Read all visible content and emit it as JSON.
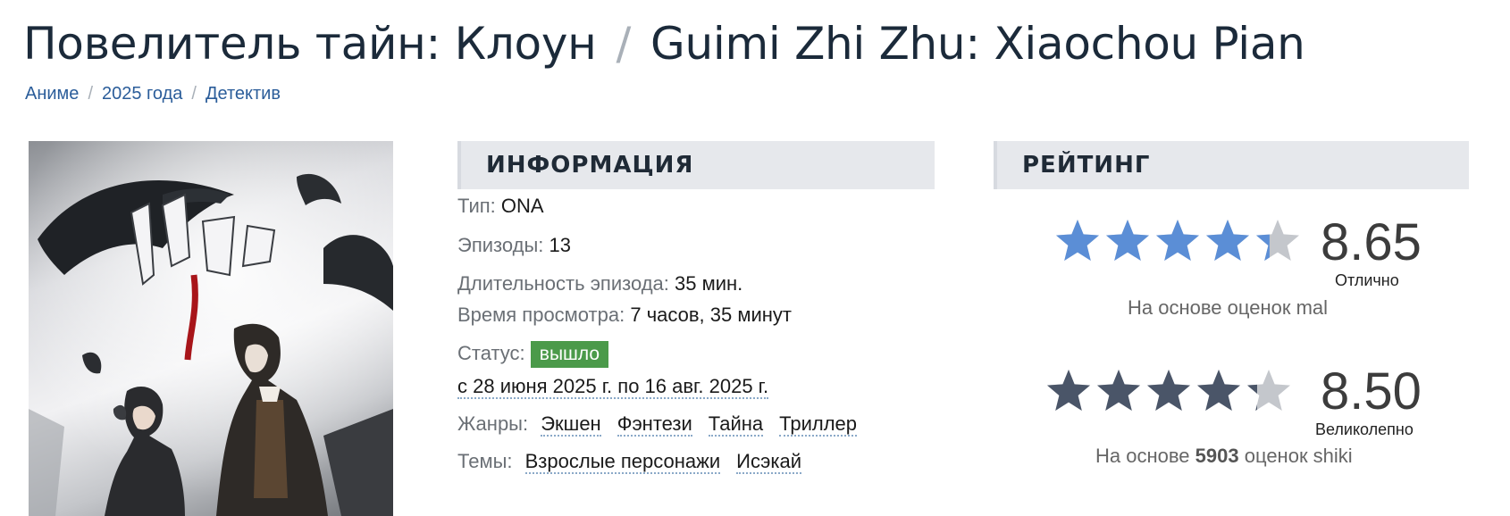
{
  "title": {
    "ru": "Повелитель тайн: Клоун",
    "separator": "/",
    "en": "Guimi Zhi Zhu: Xiaochou Pian"
  },
  "breadcrumbs": [
    {
      "label": "Аниме"
    },
    {
      "label": "2025 года"
    },
    {
      "label": "Детектив"
    }
  ],
  "info": {
    "heading": "ИНФОРМАЦИЯ",
    "type_label": "Тип:",
    "type_value": "ONA",
    "episodes_label": "Эпизоды:",
    "episodes_value": "13",
    "duration_label": "Длительность эпизода:",
    "duration_value": "35 мин.",
    "watch_time_label": "Время просмотра:",
    "watch_time_value": "7 часов, 35 минут",
    "status_label": "Статус:",
    "status_value": "вышло",
    "dates": "с 28 июня 2025 г. по 16 авг. 2025 г.",
    "genres_label": "Жанры:",
    "genres": [
      "Экшен",
      "Фэнтези",
      "Тайна",
      "Триллер"
    ],
    "themes_label": "Темы:",
    "themes": [
      "Взрослые персонажи",
      "Исэкай"
    ]
  },
  "rating": {
    "heading": "РЕЙТИНГ",
    "mal": {
      "score": "8.65",
      "stars_fraction": 0.865,
      "verdict": "Отлично",
      "basis_prefix": "На основе оценок",
      "basis_source": "mal",
      "star_color": "#5b8ed6"
    },
    "shiki": {
      "score": "8.50",
      "stars_fraction": 0.85,
      "verdict": "Великолепно",
      "basis_prefix": "На основе",
      "basis_count": "5903",
      "basis_suffix": "оценок shiki",
      "star_color": "#4a5568"
    }
  },
  "colors": {
    "status_badge": "#4b9a4a",
    "link": "#2b5d9a",
    "panel_head_bg": "#e6e8ec",
    "star_empty": "#c4c7cc"
  }
}
